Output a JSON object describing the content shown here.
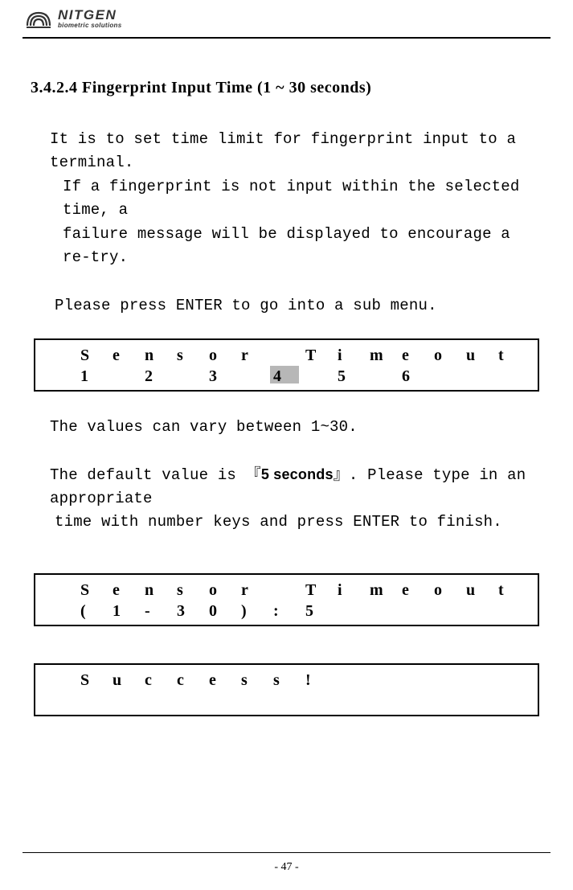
{
  "header": {
    "brand": "NITGEN",
    "tagline": "biometric solutions"
  },
  "section_title": "3.4.2.4 Fingerprint Input Time (1 ~ 30 seconds)",
  "p1_l1": "It is to set time limit for fingerprint input to a terminal.",
  "p1_l2": "If a fingerprint is not input within the selected time, a",
  "p1_l3": "failure message will be displayed to encourage a re-try.",
  "p2": "Please press ENTER to go into a sub menu.",
  "lcd1": {
    "row1": [
      "S",
      "e",
      "n",
      "s",
      "o",
      "r",
      "",
      "T",
      "i",
      "m",
      "e",
      "o",
      "u",
      "t"
    ],
    "row2": [
      "1",
      "",
      "2",
      "",
      "3",
      "",
      "4",
      "",
      "5",
      "",
      "6",
      "",
      "",
      ""
    ],
    "highlight_index": 6
  },
  "p3": "The values can vary between 1~30.",
  "p4_a": "The default value is ",
  "p4_open": "『",
  "p4_val": "5 seconds",
  "p4_close": "』",
  "p4_b": ". Please type in an appropriate",
  "p4_c": "time with number keys and press ENTER to finish.",
  "lcd2": {
    "row1": [
      "S",
      "e",
      "n",
      "s",
      "o",
      "r",
      "",
      "T",
      "i",
      "m",
      "e",
      "o",
      "u",
      "t"
    ],
    "row2": [
      "(",
      "1",
      "-",
      "3",
      "0",
      ")",
      ":",
      "5",
      "",
      "",
      "",
      "",
      "",
      ""
    ]
  },
  "lcd3": {
    "row1": [
      "S",
      "u",
      "c",
      "c",
      "e",
      "s",
      "s",
      "!",
      "",
      "",
      "",
      "",
      "",
      ""
    ],
    "row2": [
      "",
      "",
      "",
      "",
      "",
      "",
      "",
      "",
      "",
      "",
      "",
      "",
      "",
      ""
    ]
  },
  "page_number": "- 47 -"
}
